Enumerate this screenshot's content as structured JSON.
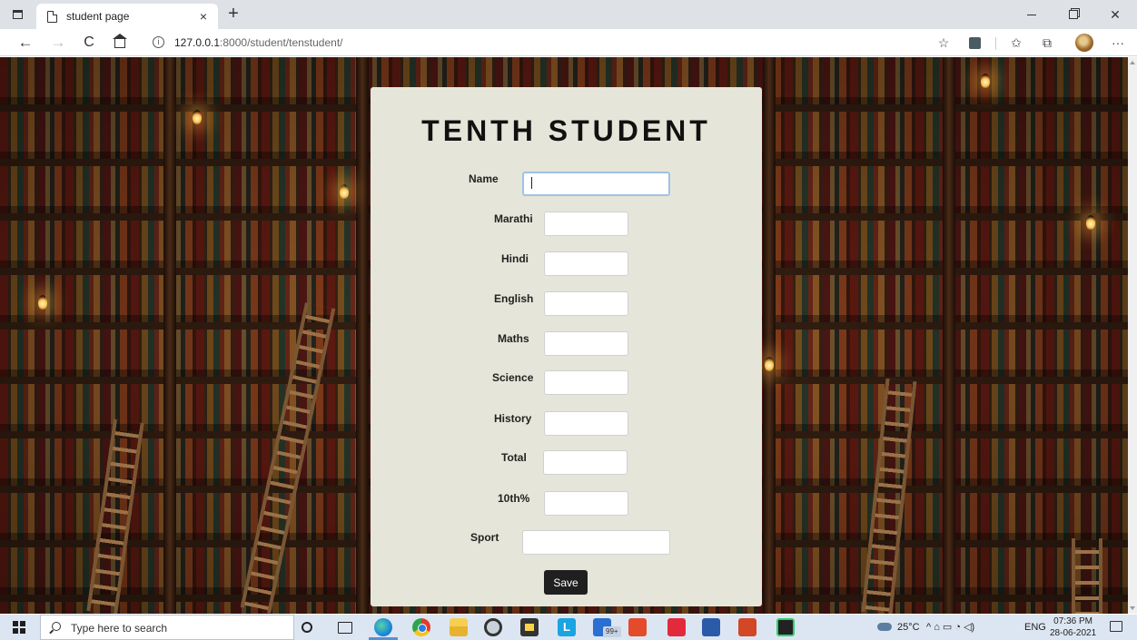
{
  "browser": {
    "tab_title": "student page",
    "tab_close": "×",
    "new_tab": "+",
    "url_host": "127.0.0.1",
    "url_rest": ":8000/student/tenstudent/",
    "nav_back": "←",
    "nav_forward": "→",
    "nav_reload": "C",
    "info": "i",
    "favorite_star": "☆",
    "favorites_bar": "✩",
    "collections": "⧉",
    "more": "···",
    "win_close": "✕"
  },
  "form": {
    "title": "TENTH STUDENT",
    "fields": [
      {
        "label": "Name",
        "value": ""
      },
      {
        "label": "Marathi",
        "value": ""
      },
      {
        "label": "Hindi",
        "value": ""
      },
      {
        "label": "English",
        "value": ""
      },
      {
        "label": "Maths",
        "value": ""
      },
      {
        "label": "Science",
        "value": ""
      },
      {
        "label": "History",
        "value": ""
      },
      {
        "label": "Total",
        "value": ""
      },
      {
        "label": "10th%",
        "value": ""
      },
      {
        "label": "Sport",
        "value": ""
      }
    ],
    "save_label": "Save"
  },
  "taskbar": {
    "search_placeholder": "Type here to search",
    "mail_badge": "99+",
    "app_l": "L",
    "temperature": "25°C",
    "tray_icons": "^ ⌂ ▭ ◔ ◁)",
    "language": "ENG",
    "time": "07:36 PM",
    "date": "28-06-2021"
  },
  "colors": {
    "card_background": "#e5e6d9",
    "save_button": "#1f1f1f",
    "focus_border": "#9fc2e6",
    "taskbar": "#dce6f2"
  },
  "icons": [
    "tab-actions-icon",
    "page-icon",
    "home-icon",
    "info-icon",
    "search-icon",
    "windows-start-icon",
    "edge-icon",
    "chrome-icon",
    "file-explorer-icon",
    "camera-icon",
    "store-icon",
    "mail-icon",
    "office-icon",
    "word-icon",
    "powerpoint-icon",
    "pycharm-icon",
    "weather-icon",
    "notification-icon"
  ]
}
